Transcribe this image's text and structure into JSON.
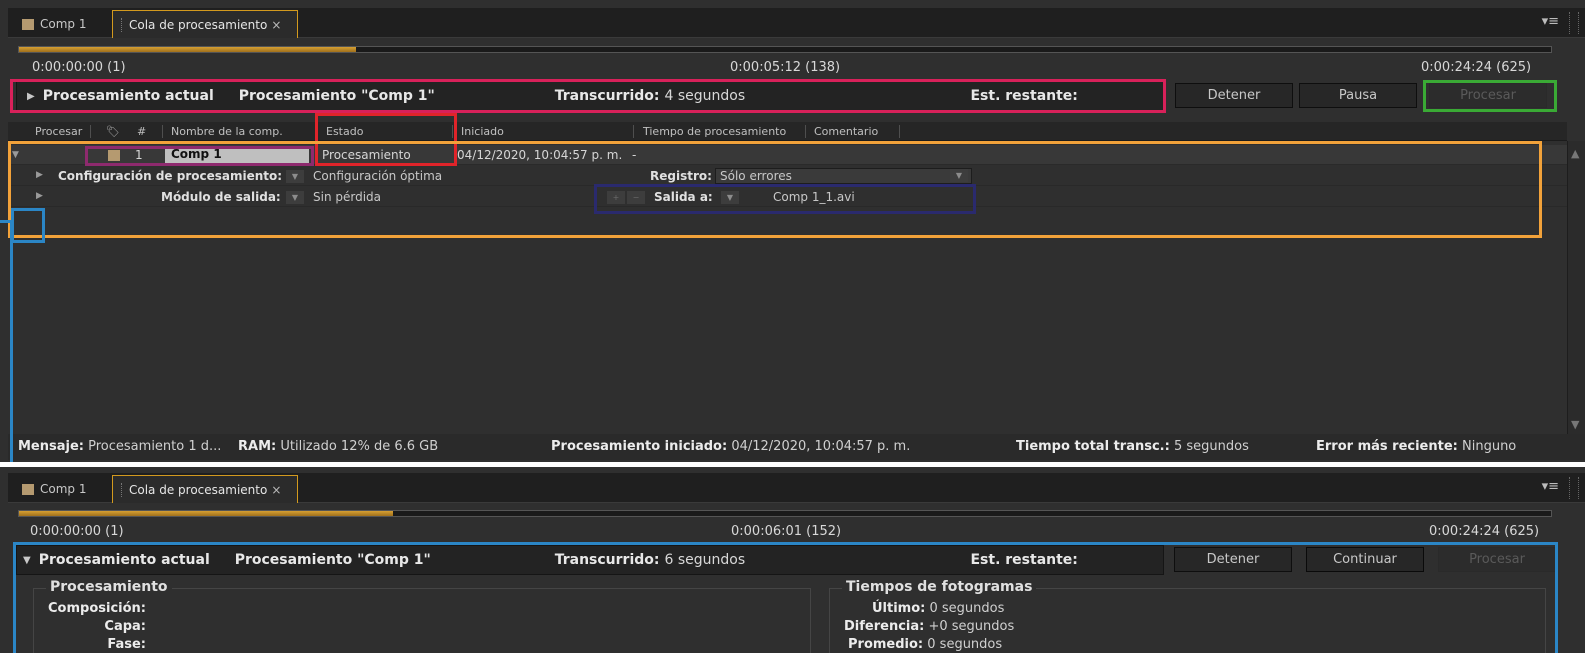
{
  "tabs": {
    "comp_tab": "Comp 1",
    "queue_tab": "Cola de procesamiento",
    "close_glyph": "×",
    "menu_glyph": "▾≡"
  },
  "panel1": {
    "progress_fraction": 0.22,
    "time_start": "0:00:00:00 (1)",
    "time_current": "0:00:05:12 (138)",
    "time_end": "0:00:24:24 (625)",
    "current_label": "Procesamiento actual",
    "current_comp": "Procesamiento \"Comp 1\"",
    "elapsed_label": "Transcurrido:",
    "elapsed_value": "4 segundos",
    "remaining_label": "Est. restante:",
    "remaining_value": "",
    "stop_button": "Detener",
    "pause_button": "Pausa",
    "render_button": "Procesar",
    "columns": {
      "render": "Procesar",
      "number": "#",
      "comp_name": "Nombre de la comp.",
      "status": "Estado",
      "started": "Iniciado",
      "render_time": "Tiempo de procesamiento",
      "comment": "Comentario"
    },
    "item": {
      "number": "1",
      "comp_name": "Comp 1",
      "status": "Procesamiento",
      "started": "04/12/2020, 10:04:57 p. m.",
      "render_time": "-"
    },
    "render_settings_label": "Configuración de procesamiento:",
    "render_settings_value": "Configuración óptima",
    "log_label": "Registro:",
    "log_value": "Sólo errores",
    "output_module_label": "Módulo de salida:",
    "output_module_value": "Sin pérdida",
    "output_to_label": "Salida a:",
    "output_to_value": "Comp 1_1.avi",
    "status_bar": {
      "message_label": "Mensaje:",
      "message_value": "Procesamiento 1 d...",
      "ram_label": "RAM:",
      "ram_value": "Utilizado 12% de 6.6 GB",
      "started_label": "Procesamiento iniciado:",
      "started_value": "04/12/2020, 10:04:57 p. m.",
      "total_label": "Tiempo total transc.:",
      "total_value": "5 segundos",
      "error_label": "Error más reciente:",
      "error_value": "Ninguno"
    }
  },
  "panel2": {
    "progress_fraction": 0.244,
    "time_start": "0:00:00:00 (1)",
    "time_current": "0:00:06:01 (152)",
    "time_end": "0:00:24:24 (625)",
    "current_label": "Procesamiento actual",
    "current_comp": "Procesamiento \"Comp 1\"",
    "elapsed_label": "Transcurrido:",
    "elapsed_value": "6 segundos",
    "remaining_label": "Est. restante:",
    "stop_button": "Detener",
    "continue_button": "Continuar",
    "render_button": "Procesar",
    "render_group": {
      "title": "Procesamiento",
      "composition_label": "Composición:",
      "layer_label": "Capa:",
      "phase_label": "Fase:"
    },
    "frames_group": {
      "title": "Tiempos de fotogramas",
      "last_label": "Último:",
      "last_value": "0 segundos",
      "diff_label": "Diferencia:",
      "diff_value": "+0 segundos",
      "avg_label": "Promedio:",
      "avg_value": "0 segundos"
    }
  },
  "highlight_colors": {
    "pink": "#d8215a",
    "green": "#3aaa35",
    "red": "#e0242a",
    "orange": "#f2a23a",
    "purple": "#8e2a6e",
    "navy": "#2a2a6e",
    "blue": "#2b86c6"
  }
}
